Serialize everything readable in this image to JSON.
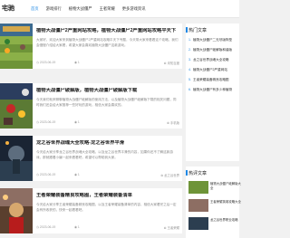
{
  "site": {
    "logo": "宅驰",
    "nav": [
      "首页",
      "游戏排行",
      "植物大战僵尸",
      "王者荣耀",
      "更多游戏资讯"
    ]
  },
  "articles": [
    {
      "title": "植物大战僵尸2严重网站攻略，植物大战僵尸2严重网站攻略平天下",
      "excerpt": "大家好，欢迎大家来到植物大战僵尸2严重网站攻略平天下专题，今天带大家来看看这个攻略，我们会慢慢介绍给大家看，希望大家会喜欢植物大战僵尸这款游戏。",
      "date": "2023-06-19",
      "views": "1",
      "tag": "未知百度"
    },
    {
      "title": "植物大战僵尸破解版，植物大战僵尸破解版下载",
      "excerpt": "今天我们就来聊聊植物大战僵尸破解版的使用方法，以及植物大战僵尸破解版下载的相关问题，同时我们还会给大家推荐一些好玩的游戏，相信大家会喜欢的。",
      "date": "2023-06-19",
      "views": "1",
      "tag": "手机版"
    },
    {
      "title": "龙之谷世界战魂大全攻略-龙之谷世界平滑",
      "excerpt": "今天给大家分享龙之谷世界战魂大全攻略，以及龙之谷世界平滑的内容，如果你还不了解这款游戏，那就跟着小编一起来看看吧，希望可以帮助到大家。",
      "date": "2023-06-19",
      "views": "1",
      "tag": "龙之谷世界"
    },
    {
      "title": "王者荣耀装备精良攻略图，王者荣耀装备清单",
      "excerpt": "今天给大家分享王者荣耀装备精良攻略图，以及王者荣耀装备清单的内容，相信大家看完之后一定会有所收获的，快来一起看看吧。",
      "date": "2023-06-19",
      "views": "1",
      "tag": "王者荣耀"
    }
  ],
  "sidebar": {
    "hot_title": "热门文章",
    "hot": [
      "植物大战僵尸二无尽版阵型",
      "植物大战僵尸破解版和谐版",
      "龙之谷世界战魂大全攻略",
      "植物大战僵尸2严重网站",
      "王者荣耀装备精良攻略图",
      "植物大战僵尸有多少种植物"
    ],
    "rec_title": "热评文章",
    "rec": [
      "植物大战僵尸破解版大全",
      "王者荣耀英雄攻略大全",
      "龙之谷世界职业攻略"
    ]
  },
  "colors": {
    "accent": "#1e88e5",
    "page_bg": "#f1f1f1"
  },
  "icons": {
    "date": "clock-icon",
    "views": "eye-icon",
    "tag": "tag-icon"
  }
}
